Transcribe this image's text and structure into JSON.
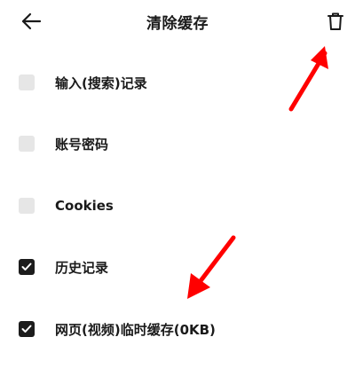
{
  "header": {
    "title": "清除缓存",
    "back_icon": "arrow-left-icon",
    "trash_icon": "trash-icon"
  },
  "items": [
    {
      "label": "输入(搜索)记录",
      "checked": false
    },
    {
      "label": "账号密码",
      "checked": false
    },
    {
      "label": "Cookies",
      "checked": false
    },
    {
      "label": "历史记录",
      "checked": true
    },
    {
      "label": "网页(视频)临时缓存(0KB)",
      "checked": true
    }
  ],
  "colors": {
    "text": "#1a1a1a",
    "checkbox_unchecked": "#e6e6e6",
    "checkbox_checked": "#1c1c1c",
    "annotation_arrow": "#ff0000"
  }
}
